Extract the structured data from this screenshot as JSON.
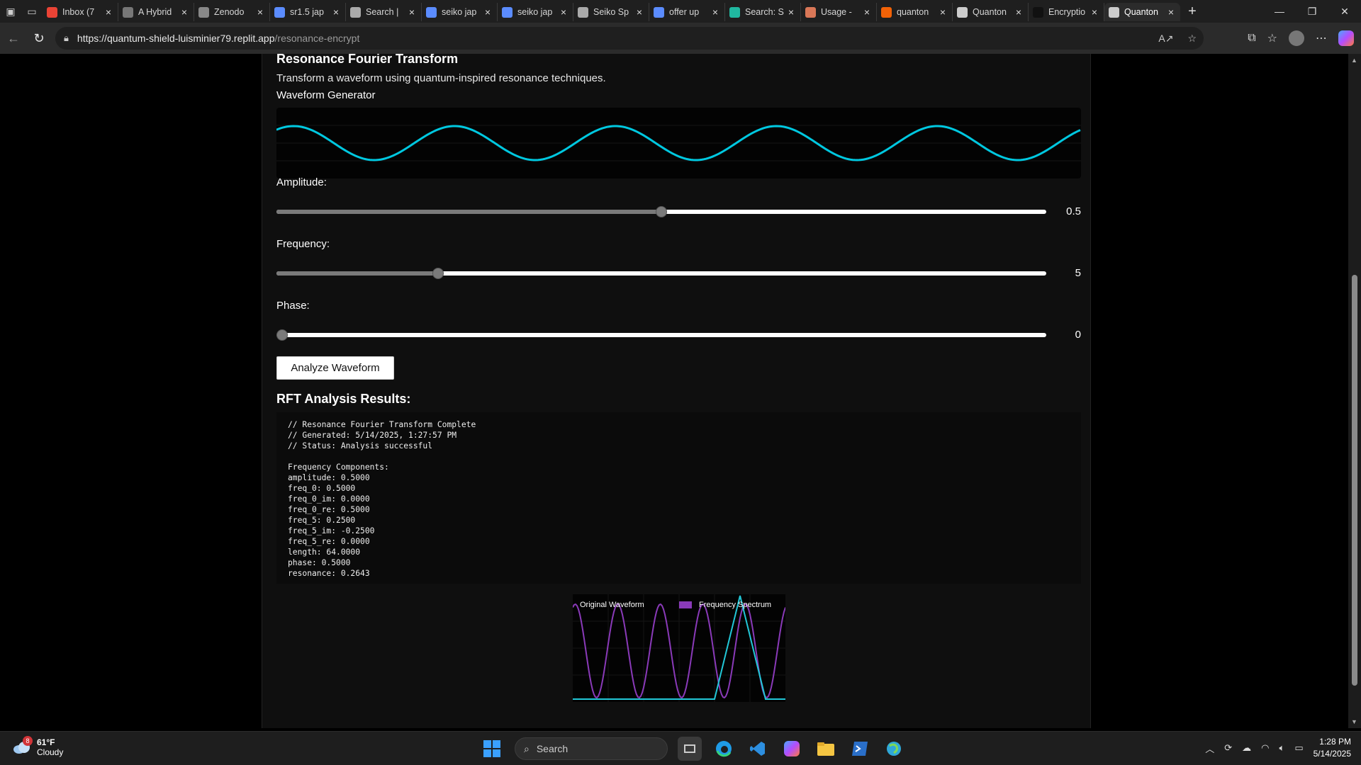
{
  "tabs": [
    {
      "label": "Inbox (7",
      "icon": "gmail-icon",
      "favColor": "#ea4335"
    },
    {
      "label": "A Hybrid",
      "icon": "zenodo-icon",
      "favColor": "#777777"
    },
    {
      "label": "Zenodo",
      "icon": "globe-icon",
      "favColor": "#888888"
    },
    {
      "label": "sr1.5 jap",
      "icon": "search-icon",
      "favColor": "#5b8cff"
    },
    {
      "label": "Search |",
      "icon": "chatgpt-icon",
      "favColor": "#aaaaaa"
    },
    {
      "label": "seiko jap",
      "icon": "search-icon",
      "favColor": "#5b8cff"
    },
    {
      "label": "seiko jap",
      "icon": "search-icon",
      "favColor": "#5b8cff"
    },
    {
      "label": "Seiko Sp",
      "icon": "loading-icon",
      "favColor": "#aaaaaa"
    },
    {
      "label": "offer up",
      "icon": "search-icon",
      "favColor": "#5b8cff"
    },
    {
      "label": "Search: S",
      "icon": "perplexity-icon",
      "favColor": "#20b8a0"
    },
    {
      "label": "Usage -",
      "icon": "claude-icon",
      "favColor": "#d97757"
    },
    {
      "label": "quanton",
      "icon": "replit-icon",
      "favColor": "#f26207"
    },
    {
      "label": "Quanton",
      "icon": "globe-icon",
      "favColor": "#cccccc"
    },
    {
      "label": "Encryptio",
      "icon": "app-icon",
      "favColor": "#111111"
    },
    {
      "label": "Quanton",
      "icon": "globe-icon",
      "favColor": "#cccccc"
    }
  ],
  "address": {
    "host": "https://quantum-shield-luisminier79.replit.app",
    "path": "/resonance-encrypt"
  },
  "page": {
    "title": "Resonance Fourier Transform",
    "description": "Transform a waveform using quantum-inspired resonance techniques.",
    "generator_label": "Waveform Generator",
    "amplitude_label": "Amplitude:",
    "amplitude_value": "0.5",
    "amplitude_fraction": 0.5,
    "frequency_label": "Frequency:",
    "frequency_value": "5",
    "frequency_fraction": 0.21,
    "phase_label": "Phase:",
    "phase_value": "0",
    "phase_fraction": 0.0,
    "analyze_button": "Analyze Waveform",
    "results_title": "RFT Analysis Results:",
    "results_text": "// Resonance Fourier Transform Complete\n// Generated: 5/14/2025, 1:27:57 PM\n// Status: Analysis successful\n\nFrequency Components:\namplitude: 0.5000\nfreq_0: 0.5000\nfreq_0_im: 0.0000\nfreq_0_re: 0.5000\nfreq_5: 0.2500\nfreq_5_im: -0.2500\nfreq_5_re: 0.0000\nlength: 64.0000\nphase: 0.5000\nresonance: 0.2643"
  },
  "chart_data": {
    "type": "line",
    "legend": [
      "Original Waveform",
      "Frequency Spectrum"
    ],
    "legend_position": "top",
    "colors": {
      "original": "#8a3ab9",
      "spectrum": "#22c8d8"
    },
    "grid": true
  },
  "colors": {
    "wave": "#00c8e0"
  },
  "taskbar": {
    "weather_temp": "61°F",
    "weather_desc": "Cloudy",
    "weather_badge": "8",
    "search_label": "Search",
    "time": "1:28 PM",
    "date": "5/14/2025"
  }
}
